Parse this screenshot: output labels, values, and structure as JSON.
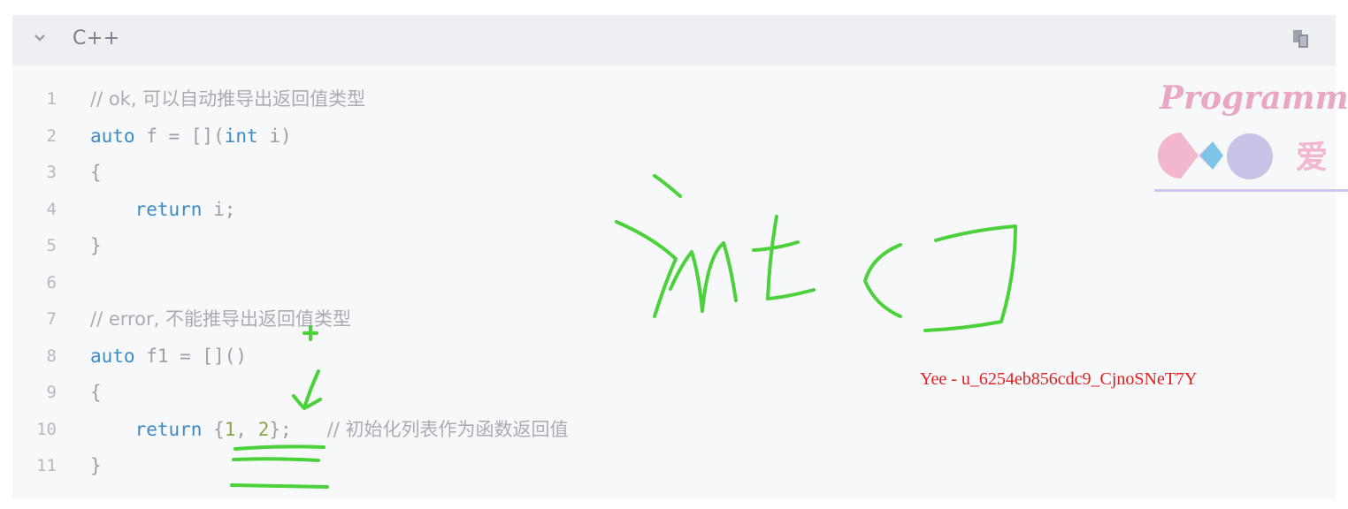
{
  "header": {
    "language": "C++",
    "collapse_icon": "chevron-down-icon",
    "copy_icon": "copy-icon"
  },
  "code": {
    "lines": [
      {
        "num": "1",
        "tokens": [
          {
            "t": "// ok, 可以自动推导出返回值类型",
            "c": "cm"
          }
        ]
      },
      {
        "num": "2",
        "tokens": [
          {
            "t": "auto",
            "c": "kw"
          },
          {
            "t": " f = [](",
            "c": ""
          },
          {
            "t": "int",
            "c": "kw"
          },
          {
            "t": " i)",
            "c": ""
          }
        ]
      },
      {
        "num": "3",
        "tokens": [
          {
            "t": "{",
            "c": ""
          }
        ]
      },
      {
        "num": "4",
        "tokens": [
          {
            "t": "    ",
            "c": ""
          },
          {
            "t": "return",
            "c": "kw"
          },
          {
            "t": " i;",
            "c": ""
          }
        ]
      },
      {
        "num": "5",
        "tokens": [
          {
            "t": "}",
            "c": ""
          }
        ]
      },
      {
        "num": "6",
        "tokens": []
      },
      {
        "num": "7",
        "tokens": [
          {
            "t": "// error, 不能推导出返回值类型",
            "c": "cm"
          }
        ]
      },
      {
        "num": "8",
        "tokens": [
          {
            "t": "auto",
            "c": "kw"
          },
          {
            "t": " f1 = []()",
            "c": ""
          }
        ]
      },
      {
        "num": "9",
        "tokens": [
          {
            "t": "{",
            "c": ""
          }
        ]
      },
      {
        "num": "10",
        "tokens": [
          {
            "t": "    ",
            "c": ""
          },
          {
            "t": "return",
            "c": "kw"
          },
          {
            "t": " {",
            "c": ""
          },
          {
            "t": "1",
            "c": "num"
          },
          {
            "t": ", ",
            "c": ""
          },
          {
            "t": "2",
            "c": "num"
          },
          {
            "t": "};",
            "c": ""
          },
          {
            "t": "      // 初始化列表作为函数返回值",
            "c": "cm"
          }
        ]
      },
      {
        "num": "11",
        "tokens": [
          {
            "t": "}",
            "c": ""
          }
        ]
      }
    ]
  },
  "watermark": {
    "text": "Yee - u_6254eb856cdc9_CjnoSNeT7Y",
    "logo_text": "Programme",
    "logo_char": "爱"
  },
  "colors": {
    "keyword": "#3f8bc4",
    "number": "#8ba34a",
    "comment": "#a9adb3",
    "annotation": "#4bd13a",
    "watermark": "#e02020"
  }
}
